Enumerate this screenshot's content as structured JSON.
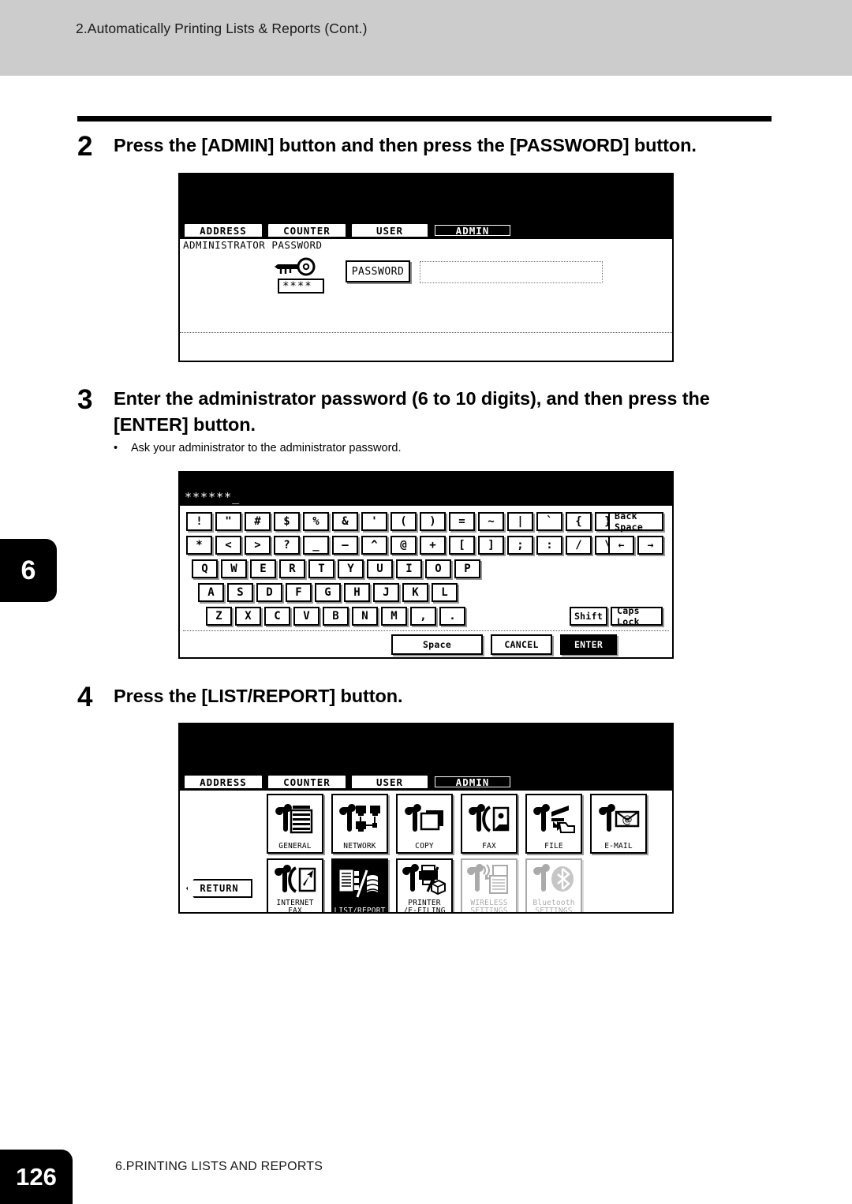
{
  "header": {
    "running_head": "2.Automatically Printing Lists & Reports (Cont.)"
  },
  "chapter_tab": {
    "number": "6"
  },
  "footer": {
    "page_number": "126",
    "chapter_title": "6.PRINTING LISTS AND REPORTS"
  },
  "steps": [
    {
      "number": "2",
      "text": "Press the [ADMIN] button and then press the [PASSWORD] button."
    },
    {
      "number": "3",
      "text": "Enter the administrator password (6 to 10 digits), and then press the [ENTER] button.",
      "bullet": "Ask your administrator to the administrator password."
    },
    {
      "number": "4",
      "text": "Press the [LIST/REPORT] button."
    }
  ],
  "panel_password": {
    "tabs": [
      {
        "label": "ADDRESS",
        "selected": false
      },
      {
        "label": "COUNTER",
        "selected": false
      },
      {
        "label": "USER",
        "selected": false
      },
      {
        "label": "ADMIN",
        "selected": true
      }
    ],
    "caption": "ADMINISTRATOR PASSWORD",
    "key_icon": "key-icon",
    "masked_sample": "****_",
    "password_button": "PASSWORD",
    "password_field_value": ""
  },
  "panel_keyboard": {
    "entry_value": "******_",
    "row1": [
      "!",
      "\"",
      "#",
      "$",
      "%",
      "&",
      "'",
      "(",
      ")",
      "=",
      "~",
      "|",
      "`",
      "{",
      "}"
    ],
    "row1_extra": [
      "Back Space"
    ],
    "row2": [
      "*",
      "<",
      ">",
      "?",
      "_",
      "—",
      "^",
      "@",
      "+",
      "[",
      "]",
      ";",
      ":",
      "/",
      "\\"
    ],
    "row2_extra": [
      "←",
      "→"
    ],
    "row3": [
      "Q",
      "W",
      "E",
      "R",
      "T",
      "Y",
      "U",
      "I",
      "O",
      "P"
    ],
    "row4": [
      "A",
      "S",
      "D",
      "F",
      "G",
      "H",
      "J",
      "K",
      "L"
    ],
    "row5": [
      "Z",
      "X",
      "C",
      "V",
      "B",
      "N",
      "M",
      ",",
      "."
    ],
    "row5_extra": [
      "Shift",
      "Caps Lock"
    ],
    "bottom": [
      {
        "label": "Space",
        "style": "normal"
      },
      {
        "label": "CANCEL",
        "style": "normal"
      },
      {
        "label": "ENTER",
        "style": "black"
      }
    ]
  },
  "panel_admin_menu": {
    "tabs": [
      {
        "label": "ADDRESS",
        "selected": false
      },
      {
        "label": "COUNTER",
        "selected": false
      },
      {
        "label": "USER",
        "selected": false
      },
      {
        "label": "ADMIN",
        "selected": true
      }
    ],
    "return_label": "RETURN",
    "items": [
      {
        "label": "GENERAL",
        "icon": "wrench-copier-icon",
        "state": "enabled"
      },
      {
        "label": "NETWORK",
        "icon": "wrench-network-icon",
        "state": "enabled"
      },
      {
        "label": "COPY",
        "icon": "wrench-copy-icon",
        "state": "enabled"
      },
      {
        "label": "FAX",
        "icon": "wrench-fax-icon",
        "state": "enabled"
      },
      {
        "label": "FILE",
        "icon": "wrench-file-icon",
        "state": "enabled"
      },
      {
        "label": "E-MAIL",
        "icon": "wrench-email-icon",
        "state": "enabled"
      },
      {
        "label": "INTERNET FAX",
        "icon": "wrench-ifax-icon",
        "state": "enabled"
      },
      {
        "label": "LIST/REPORT",
        "icon": "list-report-icon",
        "state": "selected"
      },
      {
        "label": "PRINTER\n/E-FILING",
        "icon": "wrench-printer-icon",
        "state": "enabled"
      },
      {
        "label": "WIRELESS\nSETTINGS",
        "icon": "wrench-wireless-icon",
        "state": "disabled"
      },
      {
        "label": "Bluetooth\nSETTINGS",
        "icon": "wrench-bluetooth-icon",
        "state": "disabled"
      }
    ]
  },
  "colors": {
    "band": "#cccccc",
    "ink": "#000000",
    "paper": "#ffffff"
  }
}
